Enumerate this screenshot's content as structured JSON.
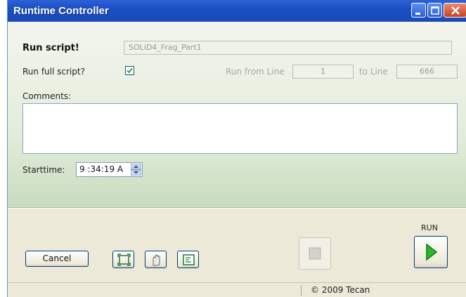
{
  "window": {
    "title": "Runtime Controller"
  },
  "form": {
    "run_script_label": "Run script!",
    "script_name": "SOLiD4_Frag_Part1",
    "run_full_label": "Run full script?",
    "run_full_checked": true,
    "run_from_label": "Run from Line",
    "run_from_value": "1",
    "to_line_label": "to Line",
    "to_line_value": "666",
    "comments_label": "Comments:",
    "comments_value": "",
    "starttime_label": "Starttime:",
    "starttime_value": "9 :34:19 A"
  },
  "actions": {
    "cancel_label": "Cancel",
    "run_label": "RUN"
  },
  "status": {
    "copyright": "© 2009 Tecan"
  },
  "colors": {
    "title_bar": "#1a4fc4",
    "form_bg": "#e3eddb",
    "run_icon": "#1ca01c"
  },
  "icons": [
    "minimize-icon",
    "maximize-icon",
    "close-icon",
    "checkmark-icon",
    "spin-up-icon",
    "spin-down-icon",
    "fit-window-icon",
    "hand-icon",
    "log-icon",
    "stop-icon",
    "play-icon"
  ]
}
